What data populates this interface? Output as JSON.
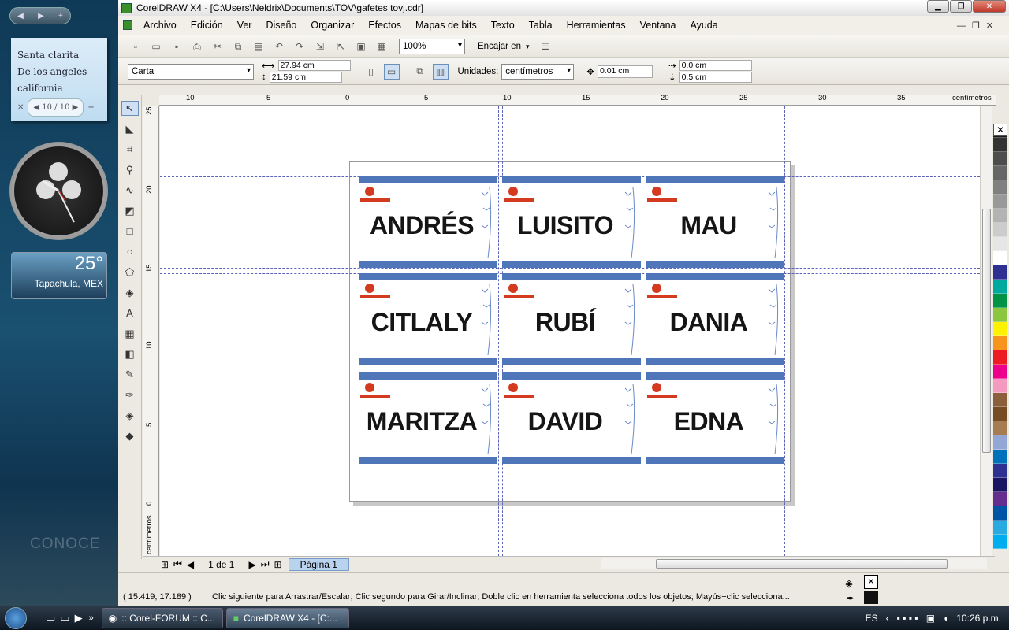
{
  "sidebar": {
    "note_lines": [
      "Santa clarita",
      "De los angeles",
      "california"
    ],
    "note_page": "10 / 10",
    "weather_temp": "25°",
    "weather_city": "Tapachula, MEX",
    "watermark": "CONOCE"
  },
  "window": {
    "title": "CorelDRAW X4 - [C:\\Users\\Neldrix\\Documents\\TOV\\gafetes tovj.cdr]"
  },
  "menu": [
    "Archivo",
    "Edición",
    "Ver",
    "Diseño",
    "Organizar",
    "Efectos",
    "Mapas de bits",
    "Texto",
    "Tabla",
    "Herramientas",
    "Ventana",
    "Ayuda"
  ],
  "toolbar": {
    "zoom": "100%",
    "snap": "Encajar en"
  },
  "property_bar": {
    "paper_size": "Carta",
    "width": "27.94 cm",
    "height": "21.59 cm",
    "units_label": "Unidades:",
    "units": "centímetros",
    "nudge": "0.01 cm",
    "dup_x": "0.0 cm",
    "dup_y": "0.5 cm"
  },
  "rulers": {
    "top": [
      "10",
      "5",
      "0",
      "5",
      "10",
      "15",
      "20",
      "25",
      "30",
      "35"
    ],
    "top_unit": "centímetros",
    "left": [
      "25",
      "20",
      "15",
      "10",
      "5",
      "0"
    ],
    "left_unit": "centímetros"
  },
  "badges": [
    "ANDRÉS",
    "LUISITO",
    "MAU",
    "CITLALY",
    "RUBÍ",
    "DANIA",
    "MARITZA",
    "DAVID",
    "EDNA"
  ],
  "page_nav": {
    "counter": "1 de 1",
    "tab": "Página 1"
  },
  "status": {
    "coords": "( 15.419, 17.189 )",
    "hint": "Clic siguiente para Arrastrar/Escalar; Clic segundo para Girar/Inclinar; Doble clic en herramienta selecciona todos los objetos; Mayús+clic selecciona..."
  },
  "taskbar": {
    "tasks": [
      ":: Corel-FORUM :: C...",
      "CorelDRAW X4 - [C:..."
    ],
    "lang": "ES",
    "time": "10:26 p.m."
  },
  "palette_colors": [
    "#1a1a1a",
    "#333",
    "#4d4d4d",
    "#666",
    "#808080",
    "#999",
    "#b3b3b3",
    "#ccc",
    "#e6e6e6",
    "#ffffff",
    "#2e3192",
    "#00a99d",
    "#009245",
    "#8cc63f",
    "#fff200",
    "#f7941d",
    "#ed1c24",
    "#ec008c",
    "#f49ac1",
    "#8b5e3c",
    "#754c24",
    "#a67c52",
    "#92a7d6",
    "#0072bc",
    "#2e3192",
    "#1b1464",
    "#662d91",
    "#0054a6",
    "#29abe2",
    "#00aeef"
  ]
}
